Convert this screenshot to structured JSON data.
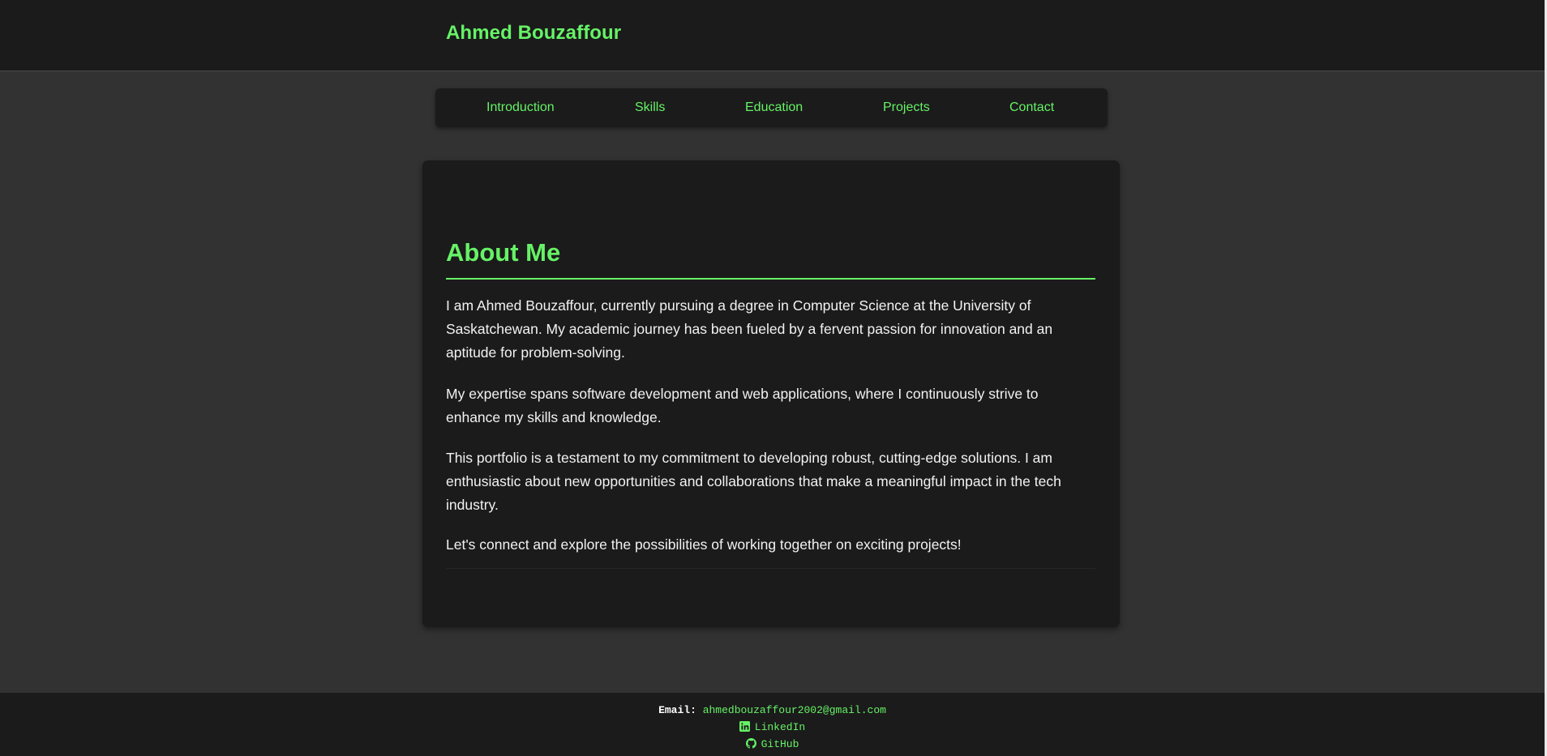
{
  "header": {
    "brand": "Ahmed Bouzaffour"
  },
  "nav": {
    "items": [
      {
        "label": "Introduction"
      },
      {
        "label": "Skills"
      },
      {
        "label": "Education"
      },
      {
        "label": "Projects"
      },
      {
        "label": "Contact"
      }
    ]
  },
  "about": {
    "title": "About Me",
    "paragraphs": [
      "I am Ahmed Bouzaffour, currently pursuing a degree in Computer Science at the University of Saskatchewan. My academic journey has been fueled by a fervent passion for innovation and an aptitude for problem-solving.",
      "My expertise spans software development and web applications, where I continuously strive to enhance my skills and knowledge.",
      "This portfolio is a testament to my commitment to developing robust, cutting-edge solutions. I am enthusiastic about new opportunities and collaborations that make a meaningful impact in the tech industry.",
      "Let's connect and explore the possibilities of working together on exciting projects!"
    ]
  },
  "footer": {
    "email_label": "Email:",
    "email": "ahmedbouzaffour2002@gmail.com",
    "linkedin_label": "LinkedIn",
    "linkedin_icon": "linkedin-icon",
    "github_label": "GitHub",
    "github_icon": "github-icon"
  },
  "colors": {
    "accent": "#66f266",
    "header_bg": "#1b1b1b",
    "page_bg": "#323232",
    "text": "#f2f2f2"
  }
}
